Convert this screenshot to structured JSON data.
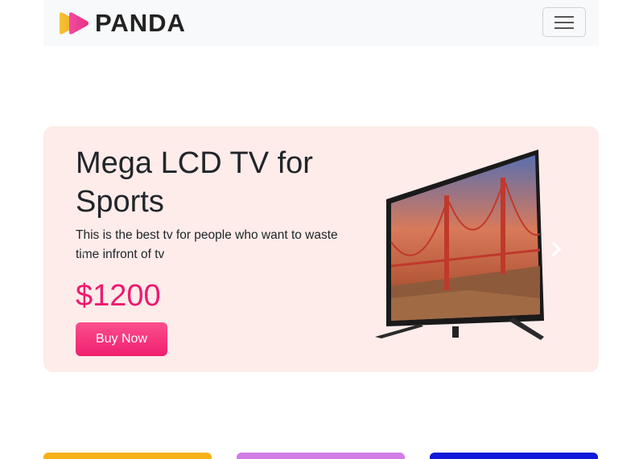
{
  "navbar": {
    "brand": "PANDA",
    "logo_icon": "play-triangles-logo",
    "toggle_icon": "hamburger-menu-icon"
  },
  "hero": {
    "title": "Mega LCD TV for Sports",
    "description": "This is the best tv for people who want to waste time infront of tv",
    "price": "$1200",
    "button_label": "Buy Now",
    "prev_icon": "chevron-left-icon",
    "next_icon": "chevron-right-icon",
    "image": "lcd-tv-golden-gate-image"
  },
  "colors": {
    "navbar_bg": "#f8f9fa",
    "hero_bg": "#fdecea",
    "accent": "#f0196e",
    "card_1": "#f7b21a",
    "card_2": "#d27de6",
    "card_3": "#1019d8"
  }
}
